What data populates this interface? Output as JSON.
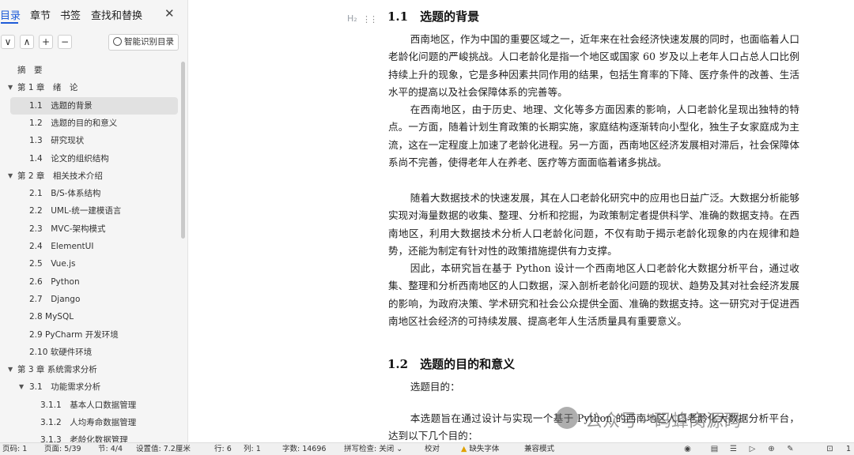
{
  "sidebar": {
    "tabs": [
      "目录",
      "章节",
      "书签",
      "查找和替换"
    ],
    "close_icon": "close-icon",
    "tool_buttons": [
      "∨",
      "∧",
      "+",
      "−"
    ],
    "smart_button_label": "智能识别目录",
    "toc": [
      {
        "label": "摘　要",
        "level": 0,
        "arrow": ""
      },
      {
        "label": "第 1 章　绪　论",
        "level": 0,
        "arrow": "▼"
      },
      {
        "label": "1.1　选题的背景",
        "level": 1,
        "arrow": "",
        "selected": true
      },
      {
        "label": "1.2　选题的目的和意义",
        "level": 1,
        "arrow": ""
      },
      {
        "label": "1.3　研究现状",
        "level": 1,
        "arrow": ""
      },
      {
        "label": "1.4　论文的组织结构",
        "level": 1,
        "arrow": ""
      },
      {
        "label": "第 2 章　相关技术介绍",
        "level": 0,
        "arrow": "▼"
      },
      {
        "label": "2.1　B/S-体系结构",
        "level": 1,
        "arrow": ""
      },
      {
        "label": "2.2　UML-统一建模语言",
        "level": 1,
        "arrow": ""
      },
      {
        "label": "2.3　MVC-架构模式",
        "level": 1,
        "arrow": ""
      },
      {
        "label": "2.4　ElementUI",
        "level": 1,
        "arrow": ""
      },
      {
        "label": "2.5　Vue.js",
        "level": 1,
        "arrow": ""
      },
      {
        "label": "2.6　Python",
        "level": 1,
        "arrow": ""
      },
      {
        "label": "2.7　Django",
        "level": 1,
        "arrow": ""
      },
      {
        "label": "2.8 MySQL",
        "level": 1,
        "arrow": ""
      },
      {
        "label": "2.9 PyCharm 开发环境",
        "level": 1,
        "arrow": ""
      },
      {
        "label": "2.10 软硬件环境",
        "level": 1,
        "arrow": ""
      },
      {
        "label": "第 3 章 系统需求分析",
        "level": 0,
        "arrow": "▼"
      },
      {
        "label": "3.1　功能需求分析",
        "level": 1,
        "arrow": "▼"
      },
      {
        "label": "3.1.1　基本人口数据管理",
        "level": 2,
        "arrow": ""
      },
      {
        "label": "3.1.2　人均寿命数据管理",
        "level": 2,
        "arrow": ""
      },
      {
        "label": "3.1.3　老龄化数据管理",
        "level": 2,
        "arrow": ""
      }
    ]
  },
  "document": {
    "heading_marker": "H₂",
    "heading1": "1.1　选题的背景",
    "paragraphs": [
      "西南地区，作为中国的重要区域之一，近年来在社会经济快速发展的同时，也面临着人口老龄化问题的严峻挑战。人口老龄化是指一个地区或国家 60 岁及以上老年人口占总人口比例持续上升的现象，它是多种因素共同作用的结果，包括生育率的下降、医疗条件的改善、生活水平的提高以及社会保障体系的完善等。",
      "在西南地区，由于历史、地理、文化等多方面因素的影响，人口老龄化呈现出独特的特点。一方面，随着计划生育政策的长期实施，家庭结构逐渐转向小型化，独生子女家庭成为主流，这在一定程度上加速了老龄化进程。另一方面，西南地区经济发展相对滞后，社会保障体系尚不完善，使得老年人在养老、医疗等方面面临着诸多挑战。",
      "随着大数据技术的快速发展，其在人口老龄化研究中的应用也日益广泛。大数据分析能够实现对海量数据的收集、整理、分析和挖掘，为政策制定者提供科学、准确的数据支持。在西南地区，利用大数据技术分析人口老龄化问题，不仅有助于揭示老龄化现象的内在规律和趋势，还能为制定有针对性的政策措施提供有力支撑。",
      "因此，本研究旨在基于 Python 设计一个西南地区人口老龄化大数据分析平台，通过收集、整理和分析西南地区的人口数据，深入剖析老龄化问题的现状、趋势及其对社会经济发展的影响，为政府决策、学术研究和社会公众提供全面、准确的数据支持。这一研究对于促进西南地区社会经济的可持续发展、提高老年人生活质量具有重要意义。"
    ],
    "heading2": "1.2　选题的目的和意义",
    "sub_label": "选题目的：",
    "last_paragraph": "本选题旨在通过设计与实现一个基于 Python 的西南地区人口老龄化大数据分析平台，达到以下几个目的："
  },
  "watermark": "公众号 · 码蜂窝源码",
  "statusbar": {
    "page_code": "页码: 1",
    "page": "页面: 5/39",
    "section": "节: 4/4",
    "setting": "设置值: 7.2厘米",
    "row": "行: 6",
    "col": "列: 1",
    "words": "字数: 14696",
    "spell": "拼写检查: 关闭 ⌄",
    "proof": "校对",
    "missing_font": "缺失字体",
    "compat": "兼容模式",
    "right_end": "1"
  }
}
